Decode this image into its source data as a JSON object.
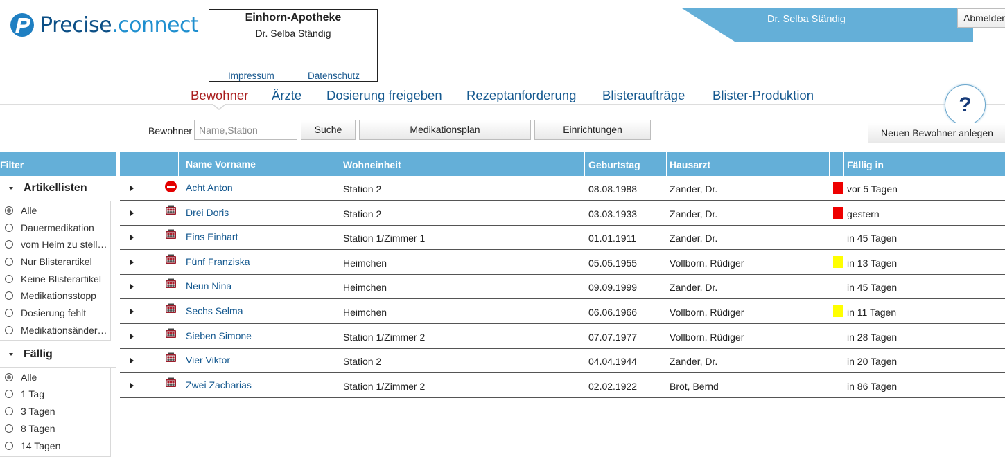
{
  "header": {
    "brand_part1": "Precise",
    "brand_part2": ".connect",
    "pharmacy_name": "Einhorn-Apotheke",
    "pharmacy_person": "Dr. Selba Ständig",
    "link_impressum": "Impressum",
    "link_datenschutz": "Datenschutz",
    "user_name": "Dr. Selba Ständig",
    "logout_label": "Abmelden",
    "banner_color": "#64afd8"
  },
  "nav": {
    "items": [
      "Bewohner",
      "Ärzte",
      "Dosierung freigeben",
      "Rezeptanforderung",
      "Blisteraufträge",
      "Blister-Produktion"
    ],
    "active": "Bewohner",
    "help_label": "?"
  },
  "search": {
    "label": "Bewohner",
    "placeholder": "Name,Station",
    "value": "",
    "search_button": "Suche",
    "medplan_button": "Medikationsplan",
    "facilities_button": "Einrichtungen",
    "new_resident_button": "Neuen Bewohner anlegen"
  },
  "filter": {
    "header": "Filter",
    "sections": [
      {
        "title": "Artikellisten",
        "options": [
          "Alle",
          "Dauermedikation",
          "vom Heim zu stellende",
          "Nur Blisterartikel",
          "Keine Blisterartikel",
          "Medikationsstopp",
          "Dosierung fehlt",
          "Medikationsänderung"
        ],
        "selected": "Alle"
      },
      {
        "title": "Fällig",
        "options": [
          "Alle",
          "1 Tag",
          "3 Tagen",
          "8 Tagen",
          "14 Tagen"
        ],
        "selected": "Alle"
      }
    ]
  },
  "table": {
    "columns": [
      "Name Vorname",
      "Wohneinheit",
      "Geburtstag",
      "Hausarzt",
      "Fällig in"
    ],
    "rows": [
      {
        "icon": "stop-icon",
        "name": "Acht Anton",
        "unit": "Station 2",
        "birthday": "08.08.1988",
        "doctor": "Zander, Dr.",
        "flag": "red",
        "due": "vor 5 Tagen"
      },
      {
        "icon": "blister-icon",
        "name": "Drei Doris",
        "unit": "Station 2",
        "birthday": "03.03.1933",
        "doctor": "Zander, Dr.",
        "flag": "red",
        "due": "gestern"
      },
      {
        "icon": "blister-icon",
        "name": "Eins Einhart",
        "unit": "Station 1/Zimmer 1",
        "birthday": "01.01.1911",
        "doctor": "Zander, Dr.",
        "flag": "none",
        "due": "in 45 Tagen"
      },
      {
        "icon": "blister-icon",
        "name": "Fünf Franziska",
        "unit": "Heimchen",
        "birthday": "05.05.1955",
        "doctor": "Vollborn, Rüdiger",
        "flag": "yellow",
        "due": "in 13 Tagen"
      },
      {
        "icon": "blister-icon",
        "name": "Neun Nina",
        "unit": "Heimchen",
        "birthday": "09.09.1999",
        "doctor": "Zander, Dr.",
        "flag": "none",
        "due": "in 45 Tagen"
      },
      {
        "icon": "blister-icon",
        "name": "Sechs Selma",
        "unit": "Heimchen",
        "birthday": "06.06.1966",
        "doctor": "Vollborn, Rüdiger",
        "flag": "yellow",
        "due": "in 11 Tagen"
      },
      {
        "icon": "blister-icon",
        "name": "Sieben Simone",
        "unit": "Station 1/Zimmer 2",
        "birthday": "07.07.1977",
        "doctor": "Vollborn, Rüdiger",
        "flag": "none",
        "due": "in 28 Tagen"
      },
      {
        "icon": "blister-icon",
        "name": "Vier Viktor",
        "unit": "Station 2",
        "birthday": "04.04.1944",
        "doctor": "Zander, Dr.",
        "flag": "none",
        "due": "in 20 Tagen"
      },
      {
        "icon": "blister-icon",
        "name": "Zwei Zacharias",
        "unit": "Station 1/Zimmer 2",
        "birthday": "02.02.1922",
        "doctor": "Brot, Bernd",
        "flag": "none",
        "due": "in 86 Tagen"
      }
    ],
    "flag_colors": {
      "red": "#ee0000",
      "yellow": "#ffff00"
    }
  }
}
